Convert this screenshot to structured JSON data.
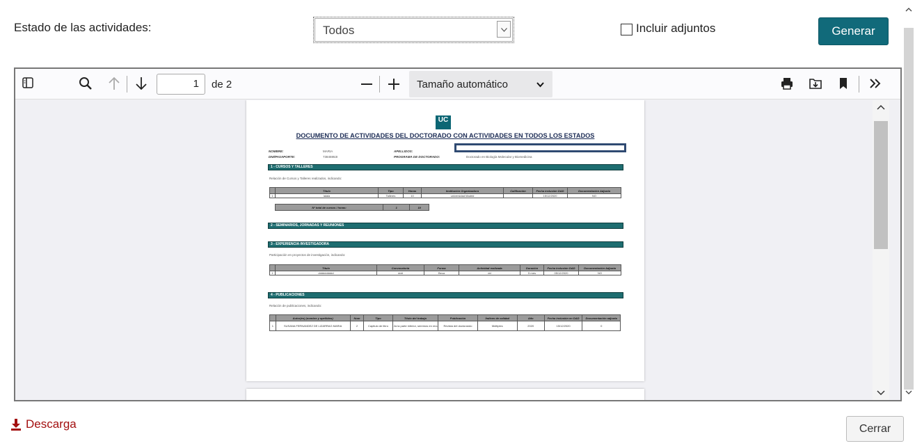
{
  "filters": {
    "status_label": "Estado de las actividades:",
    "status_selected": "Todos",
    "include_attachments_label": "Incluir adjuntos",
    "include_attachments_checked": false,
    "generate_button": "Generar"
  },
  "viewer": {
    "current_page": "1",
    "total_pages": "de 2",
    "zoom": "Tamaño automático",
    "icons": [
      "sidebar-toggle-icon",
      "search-icon",
      "arrow-up-icon",
      "arrow-down-icon",
      "zoom-out-icon",
      "zoom-in-icon",
      "chevron-down-icon",
      "print-icon",
      "save-icon",
      "bookmark-icon",
      "double-chevron-right-icon"
    ]
  },
  "document": {
    "logo": "UC",
    "title": "DOCUMENTO DE ACTIVIDADES DEL DOCTORADO CON ACTIVIDADES EN TODOS LOS ESTADOS",
    "fields": {
      "nombre_label": "NOMBRE:",
      "nombre_value": "MARIA",
      "dni_label": "DNI/PASAPORTE:",
      "dni_value": "73845953I",
      "apellidos_label": "APELLIDOS:",
      "programa_label": "PROGRAMA DE DOCTORADO:",
      "programa_value": "Doctorado en Biología Molecular y Biomedicina"
    },
    "sections": [
      {
        "title": "1 - CURSOS Y TALLERES",
        "intro": "Relación de Cursos y Talleres realizados, indicando:",
        "headers": [
          "",
          "Título",
          "Tipo",
          "Horas",
          "Institución Organizadora",
          "Calificación",
          "Fecha inclusión DAD",
          "Documentación Adjunta"
        ],
        "rows": [
          [
            "1",
            "lalala",
            "Talleres",
            "10",
            "universidad Madrid",
            "",
            "15/12/2020",
            "NO"
          ]
        ],
        "total": [
          "Nº total de cursos / horas:",
          "1",
          "10"
        ]
      },
      {
        "title": "2 - SEMINARIOS, JORNADAS Y REUNIONES"
      },
      {
        "title": "3 - EXPERIENCIA INVESTIGADORA",
        "intro": "Participación en proyectos de investigación, indicando:",
        "headers": [
          "",
          "Título",
          "Convocatoria",
          "Forma",
          "Actividad realizada",
          "Duración",
          "Fecha inclusión DAD",
          "Documentación Adjunta"
        ],
        "rows": [
          [
            "1",
            "dddddddddd",
            "ddd",
            "Beca",
            "dd",
            "5 mes",
            "05/12/2020",
            "NO"
          ]
        ]
      },
      {
        "title": "4 - PUBLICACIONES",
        "intro": "Relación de publicaciones, indicando:",
        "headers": [
          "",
          "Autor(es) (nombre y apellidos)",
          "Num",
          "Tipo",
          "Título del trabajo",
          "Publicación",
          "Índices de calidad",
          "Año",
          "Fecha inclusión en DAD",
          "Documentación adjunta"
        ],
        "rows": [
          [
            "1",
            "SUSANA FERNANDEZ DE LIZARRAG MARIA",
            "2",
            "Capitulo de libro",
            "2a la parte inferior, seremos en recuerdo del 2020",
            "Revista del doctorando",
            "Múltiples",
            "2020",
            "15/12/2020",
            "0"
          ]
        ]
      }
    ]
  },
  "footer": {
    "download_label": "Descarga",
    "close_button": "Cerrar"
  }
}
